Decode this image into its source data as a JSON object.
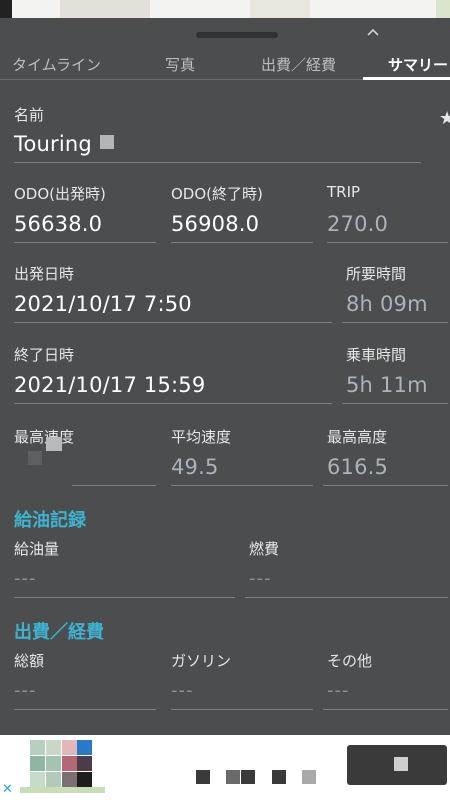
{
  "tabs": [
    {
      "label": "タイムライン"
    },
    {
      "label": "写真"
    },
    {
      "label": "出費／経費"
    },
    {
      "label": "サマリー"
    }
  ],
  "name": {
    "label": "名前",
    "value": "Touring"
  },
  "odo_start": {
    "label": "ODO(出発時)",
    "value": "56638.0"
  },
  "odo_end": {
    "label": "ODO(終了時)",
    "value": "56908.0"
  },
  "trip": {
    "label": "TRIP",
    "value": "270.0"
  },
  "departure": {
    "label": "出発日時",
    "value": "2021/10/17 7:50"
  },
  "required_time": {
    "label": "所要時間",
    "value": "8h 09m"
  },
  "end_time": {
    "label": "終了日時",
    "value": "2021/10/17 15:59"
  },
  "riding_time": {
    "label": "乗車時間",
    "value": "5h 11m"
  },
  "max_speed": {
    "label": "最高速度"
  },
  "avg_speed": {
    "label": "平均速度",
    "value": "49.5"
  },
  "max_altitude": {
    "label": "最高高度",
    "value": "616.5"
  },
  "fuel_section": {
    "title": "給油記録",
    "amount_label": "給油量",
    "amount_value": "---",
    "efficiency_label": "燃費",
    "efficiency_value": "---"
  },
  "expense_section": {
    "title": "出費／経費",
    "total_label": "総額",
    "total_value": "---",
    "gasoline_label": "ガソリン",
    "gasoline_value": "---",
    "other_label": "その他",
    "other_value": "---"
  },
  "icons": {
    "star": "star-icon",
    "chevron": "chevron-up-icon",
    "ad_close": "close-icon"
  },
  "colors": {
    "sheet_bg": "#4b4d4f",
    "section_title": "#3fb2cf",
    "muted_value": "#a9b3bd"
  }
}
